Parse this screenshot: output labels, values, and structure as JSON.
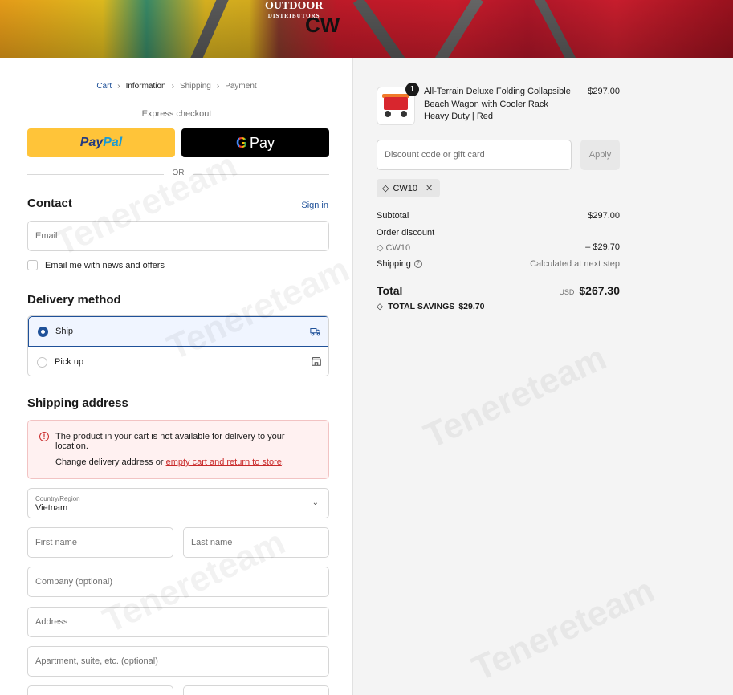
{
  "banner": {
    "logo_main": "OUTDOOR",
    "logo_sub": "DISTRIBUTORS",
    "store_mark": "CW"
  },
  "breadcrumb": [
    "Cart",
    "Information",
    "Shipping",
    "Payment"
  ],
  "express": {
    "label": "Express checkout",
    "paypal_p1": "Pay",
    "paypal_p2": "Pal",
    "gpay_g": "G",
    "gpay_text": "Pay",
    "or": "OR"
  },
  "contact": {
    "title": "Contact",
    "signin": "Sign in",
    "email_placeholder": "Email",
    "newsletter": "Email me with news and offers"
  },
  "delivery": {
    "title": "Delivery method",
    "ship": "Ship",
    "pickup": "Pick up"
  },
  "shipping": {
    "title": "Shipping address",
    "alert_text": "The product in your cart is not available for delivery to your location.",
    "alert_line2_prefix": "Change delivery address or ",
    "alert_link": "empty cart and return to store",
    "alert_suffix": ".",
    "country_label": "Country/Region",
    "country_value": "Vietnam",
    "first_name": "First name",
    "last_name": "Last name",
    "company": "Company (optional)",
    "address": "Address",
    "apartment": "Apartment, suite, etc. (optional)"
  },
  "summary": {
    "qty": "1",
    "product_name": "All-Terrain Deluxe Folding Collapsible Beach Wagon with Cooler Rack | Heavy Duty | Red",
    "product_price": "$297.00",
    "discount_placeholder": "Discount code or gift card",
    "apply": "Apply",
    "code_tag": "CW10",
    "subtotal_label": "Subtotal",
    "subtotal_value": "$297.00",
    "order_discount_label": "Order discount",
    "discount_code": "CW10",
    "discount_value": "– $29.70",
    "shipping_label": "Shipping",
    "shipping_value": "Calculated at next step",
    "total_label": "Total",
    "currency": "USD",
    "total_value": "$267.30",
    "savings_label": "TOTAL SAVINGS",
    "savings_value": "$29.70"
  },
  "colors": {
    "link": "#1f5199",
    "accent": "#1f5199",
    "error": "#c92a2a",
    "paypal": "#ffc439"
  },
  "watermark": "Tenereteam"
}
